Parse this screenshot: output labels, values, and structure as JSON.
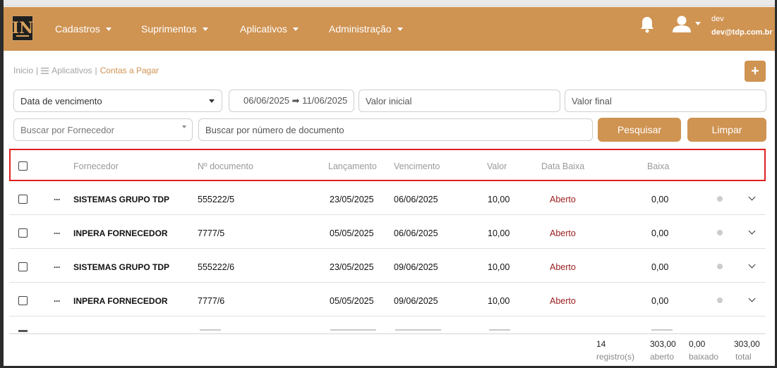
{
  "brand": {
    "logo_text": "IN"
  },
  "nav": {
    "items": [
      {
        "label": "Cadastros"
      },
      {
        "label": "Suprimentos"
      },
      {
        "label": "Aplicativos"
      },
      {
        "label": "Administração"
      }
    ],
    "user": {
      "name": "dev",
      "email": "dev@tdp.com.br"
    }
  },
  "breadcrumb": {
    "home": "Inicio",
    "sep1": "|",
    "apps": "Aplicativos",
    "sep2": "|",
    "current": "Contas a Pagar"
  },
  "add_button": {
    "label": "+"
  },
  "filters": {
    "date_type": "Data de vencimento",
    "date_range": "06/06/2025 ➡ 11/06/2025",
    "valor_inicial": "Valor inicial",
    "valor_final": "Valor final",
    "fornecedor_placeholder": "Buscar por Fornecedor",
    "documento_placeholder": "Buscar por número de documento",
    "search_label": "Pesquisar",
    "clear_label": "Limpar"
  },
  "table": {
    "headers": {
      "fornecedor": "Fornecedor",
      "documento": "Nº documento",
      "lancamento": "Lançamento",
      "vencimento": "Vencimento",
      "valor": "Valor",
      "data_baixa": "Data Baixa",
      "baixa": "Baixa"
    },
    "rows": [
      {
        "fornecedor": "SISTEMAS GRUPO TDP",
        "documento": "555222/5",
        "lancamento": "23/05/2025",
        "vencimento": "06/06/2025",
        "valor": "10,00",
        "status": "Aberto",
        "baixa": "0,00"
      },
      {
        "fornecedor": "INPERA FORNECEDOR",
        "documento": "7777/5",
        "lancamento": "05/05/2025",
        "vencimento": "06/06/2025",
        "valor": "10,00",
        "status": "Aberto",
        "baixa": "0,00"
      },
      {
        "fornecedor": "SISTEMAS GRUPO TDP",
        "documento": "555222/6",
        "lancamento": "23/05/2025",
        "vencimento": "09/06/2025",
        "valor": "10,00",
        "status": "Aberto",
        "baixa": "0,00"
      },
      {
        "fornecedor": "INPERA FORNECEDOR",
        "documento": "7777/6",
        "lancamento": "05/05/2025",
        "vencimento": "09/06/2025",
        "valor": "10,00",
        "status": "Aberto",
        "baixa": "0,00"
      }
    ]
  },
  "footer": {
    "registros_value": "14",
    "registros_label": "registro(s)",
    "aberto_value": "303,00",
    "aberto_label": "aberto",
    "baixado_value": "0,00",
    "baixado_label": "baixado",
    "total_value": "303,00",
    "total_label": "total"
  },
  "colors": {
    "accent": "#cf9352",
    "status_open": "#9b1b1b",
    "highlight_border": "#e02020"
  },
  "icons": [
    "bell-icon",
    "user-icon",
    "menu-icon",
    "more-dots-icon",
    "chevron-down-icon",
    "arrow-right-icon",
    "plus-icon"
  ]
}
